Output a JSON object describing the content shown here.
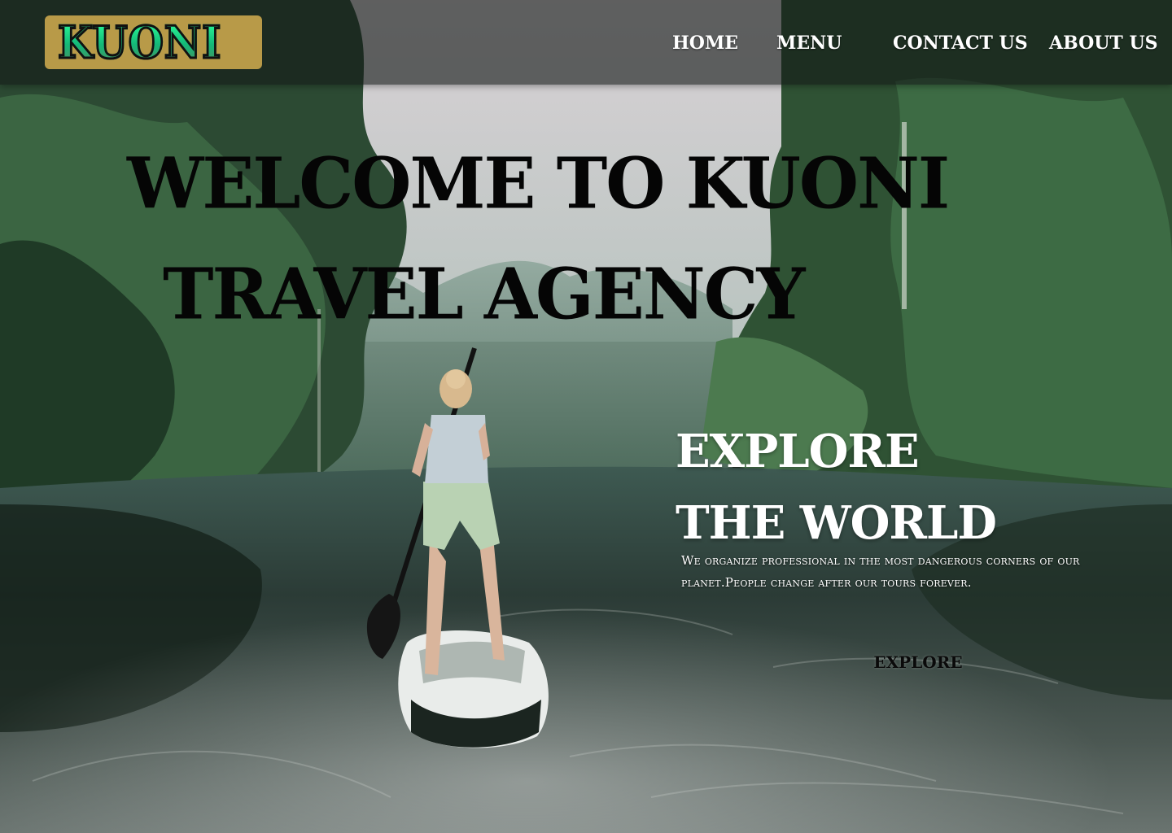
{
  "header": {
    "logo_text": "KUONI",
    "nav": {
      "home": "HOME",
      "menu": "MENU",
      "contact": "CONTACT US",
      "about": "ABOUT US"
    }
  },
  "hero": {
    "title_line_1": "WELCOME TO KUONI",
    "title_line_2": "TRAVEL AGENCY"
  },
  "explore": {
    "heading_line_1": "EXPLORE",
    "heading_line_2": "THE WORLD",
    "description": "We organize professional in the most dangerous corners of our planet.People change after our tours forever.",
    "button_label": "EXPLORE"
  },
  "colors": {
    "header_bg": "#141816",
    "logo_bg": "#b89a48",
    "logo_text": "#1fd68c",
    "hero_title": "#050505",
    "explore_text": "#ffffff"
  }
}
